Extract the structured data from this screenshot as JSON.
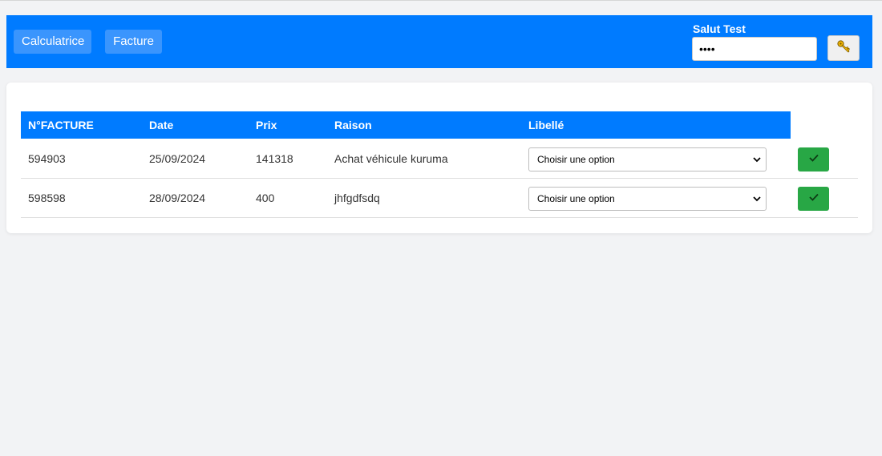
{
  "nav": {
    "buttons": [
      {
        "label": "Calculatrice"
      },
      {
        "label": "Facture"
      }
    ],
    "greeting": "Salut Test",
    "password_value": "••••",
    "login_icon": "key-icon"
  },
  "table": {
    "columns": [
      "N°FACTURE",
      "Date",
      "Prix",
      "Raison",
      "Libellé"
    ],
    "rows": [
      {
        "numero": "594903",
        "date": "25/09/2024",
        "prix": "141318",
        "raison": "Achat véhicule kuruma",
        "libelle": "Choisir une option"
      },
      {
        "numero": "598598",
        "date": "28/09/2024",
        "prix": "400",
        "raison": "jhfgdfsdq",
        "libelle": "Choisir une option"
      }
    ],
    "action_icon": "checkmark-icon"
  },
  "colors": {
    "primary": "#007bff",
    "success": "#28a745",
    "background": "#f2f3f5"
  }
}
